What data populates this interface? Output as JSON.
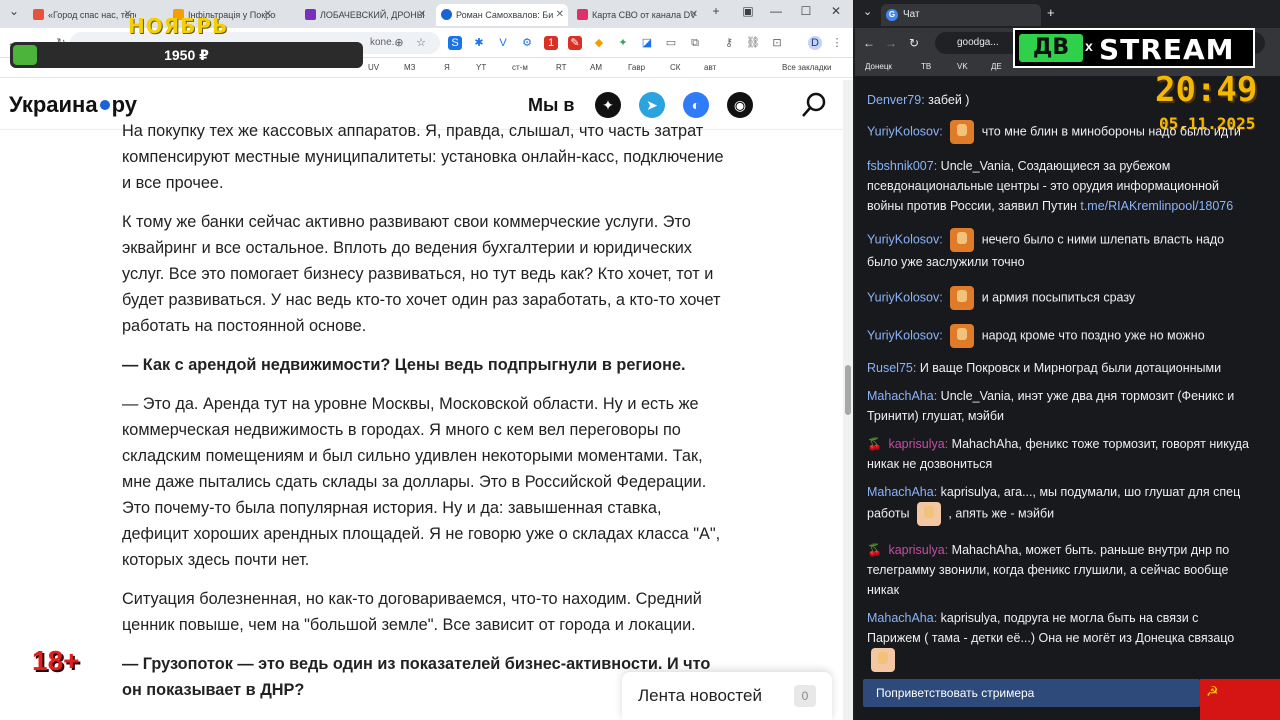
{
  "left_browser": {
    "tabs": [
      {
        "label": "«Город спас нас, тепер",
        "color": "#e8523d"
      },
      {
        "label": "Інфільтрація у Покровськ",
        "color": "#f1a000"
      },
      {
        "label": "ЛОБАЧЕВСКИЙ, ДРОНЫ",
        "color": "#7a2fbf"
      },
      {
        "label": "Роман Самохвалов: Би",
        "color": "#1a63d6"
      },
      {
        "label": "Карта СВО от канала DV",
        "color": "#e0306b"
      }
    ],
    "new_tab": "+",
    "address_fragment": "kone...",
    "bookmarks": [
      "UV",
      "МЗ",
      "Я",
      "YT",
      "ст-м",
      "RT",
      "АМ",
      "Гавр",
      "СК",
      "авт",
      "Все закладки"
    ]
  },
  "promo": {
    "month": "НОЯБРЬ",
    "amount": "1950 ₽",
    "progress": 0.07
  },
  "site": {
    "logo_prefix": "Украина",
    "logo_suffix": "ру",
    "mi_v": "Мы в"
  },
  "article": {
    "p1": "На покупку тех же кассовых аппаратов. Я, правда, слышал, что часть затрат компенсируют местные муниципалитеты: установка онлайн-касс, подключение и все прочее.",
    "p2": "К тому же банки сейчас активно развивают свои коммерческие услуги. Это эквайринг и все остальное. Вплоть до ведения бухгалтерии и юридических услуг. Все это помогает бизнесу развиваться, но тут ведь как? Кто хочет, тот и будет развиваться. У нас ведь кто-то хочет один раз заработать, а кто-то хочет работать на постоянной основе.",
    "q1": "— Как с арендой недвижимости? Цены ведь подпрыгнули в регионе.",
    "p3": "— Это да. Аренда тут на уровне Москвы, Московской области. Ну и есть же коммерческая недвижимость в городах. Я много с кем вел переговоры по складским помещениям и был сильно удивлен некоторыми моментами. Так, мне даже пытались сдать склады за доллары. Это в Российской Федерации. Это почему-то была популярная история. Ну и да: завышенная ставка, дефицит хороших арендных площадей. Я не говорю уже о складах класса \"А\", которых здесь почти нет.",
    "p4": "Ситуация болезненная, но как-то договариваемся, что-то находим. Средний ценник повыше, чем на \"большой земле\". Все зависит от города и локации.",
    "q2": "— Грузопоток — это ведь один из показателей бизнес-активности. И что он показывает в ДНР?"
  },
  "overlay": {
    "age": "18+"
  },
  "news_feed": {
    "label": "Лента новостей",
    "count": "0"
  },
  "right_browser": {
    "tab_title": "Чат",
    "address": "goodga...",
    "bookmarks": [
      "Донецк",
      "ТВ",
      "VK",
      "ДЕ"
    ]
  },
  "stream": {
    "logo_left": "ДВ",
    "logo_x": "x",
    "logo_right": "STREAM",
    "time": "20:49",
    "date": "05.11.2025"
  },
  "chat": {
    "messages": [
      {
        "user": "Denver79:",
        "color": "#8ab4f8",
        "text": "забей )"
      },
      {
        "user": "YuriyKolosov:",
        "color": "#8ab4f8",
        "text": "что мне блин в минобороны надо было идти"
      },
      {
        "user": "fsbshnik007:",
        "color": "#8ab4f8",
        "text": "Uncle_Vania, Создающиеся за рубежом псевдонациональные центры - это орудия информационной войны против России, заявил Путин",
        "link": "t.me/RIAKremlinpool/18076"
      },
      {
        "user": "YuriyKolosov:",
        "color": "#8ab4f8",
        "text": "нечего было с ними шлепать власть надо было уже заслужили точно"
      },
      {
        "user": "YuriyKolosov:",
        "color": "#8ab4f8",
        "text": "и армия посыпиться сразу"
      },
      {
        "user": "YuriyKolosov:",
        "color": "#8ab4f8",
        "text": "народ кроме что поздно уже но можно"
      },
      {
        "user": "Rusel75:",
        "color": "#8ab4f8",
        "text": "И ваще Покровск и Мирноград были дотационными"
      },
      {
        "user": "MahachAha:",
        "color": "#8ab4f8",
        "text": "Uncle_Vania, инэт уже два дня тормозит (Феникс и Тринити) глушат, мэйби"
      },
      {
        "user": "kaprisulya:",
        "color": "#c14fa3",
        "text": "MahachAha, феникс тоже тормозит, говорят никуда никак не дозвониться"
      },
      {
        "user": "MahachAha:",
        "color": "#8ab4f8",
        "text": "kaprisulya, ага..., мы подумали, шо глушат для спец работы",
        "tail": ", апять же - мэйби"
      },
      {
        "user": "kaprisulya:",
        "color": "#c14fa3",
        "text": "MahachAha, может быть. раньше внутри днр по телеграмму звонили, когда феникс глушили, а сейчас вообще никак"
      },
      {
        "user": "MahachAha:",
        "color": "#8ab4f8",
        "text": "kaprisulya, подруга не могла быть на связи с Парижем ( тама - детки её...) Она не могёт из Донецка связацо"
      }
    ],
    "greet_button": "Поприветствовать стримера"
  }
}
